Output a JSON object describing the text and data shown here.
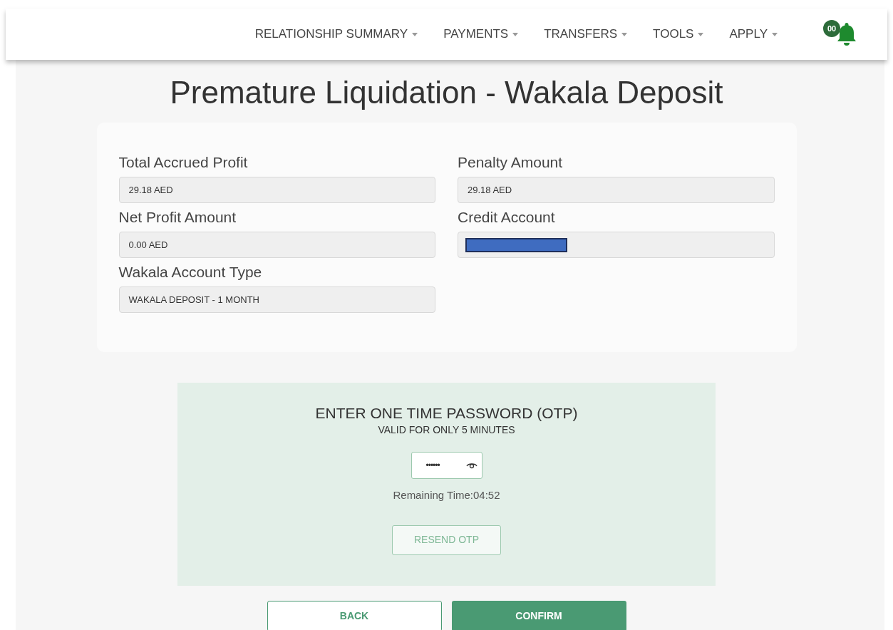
{
  "nav": {
    "items": [
      {
        "label": "RELATIONSHIP SUMMARY"
      },
      {
        "label": "PAYMENTS"
      },
      {
        "label": "TRANSFERS"
      },
      {
        "label": "TOOLS"
      },
      {
        "label": "APPLY"
      }
    ],
    "notification_badge": "00"
  },
  "title": "Premature Liquidation - Wakala Deposit",
  "fields": [
    {
      "label": "Total Accrued Profit",
      "kind": "text",
      "value": "29.18 AED"
    },
    {
      "label": "Penalty Amount",
      "kind": "text",
      "value": "29.18 AED"
    },
    {
      "label": "Net Profit Amount",
      "kind": "text",
      "value": "0.00 AED"
    },
    {
      "label": "Credit Account",
      "kind": "redacted"
    },
    {
      "label": "Wakala Account Type",
      "kind": "text",
      "value": "WAKALA DEPOSIT - 1 MONTH"
    }
  ],
  "otp": {
    "heading": "ENTER ONE TIME PASSWORD (OTP)",
    "subheading": "VALID FOR ONLY 5 MINUTES",
    "value": "••••••",
    "remaining": "Remaining Time:04:52",
    "resend": "RESEND OTP"
  },
  "buttons": [
    {
      "label": "BACK",
      "kind": "secondary"
    },
    {
      "label": "CONFIRM",
      "kind": "primary"
    }
  ]
}
